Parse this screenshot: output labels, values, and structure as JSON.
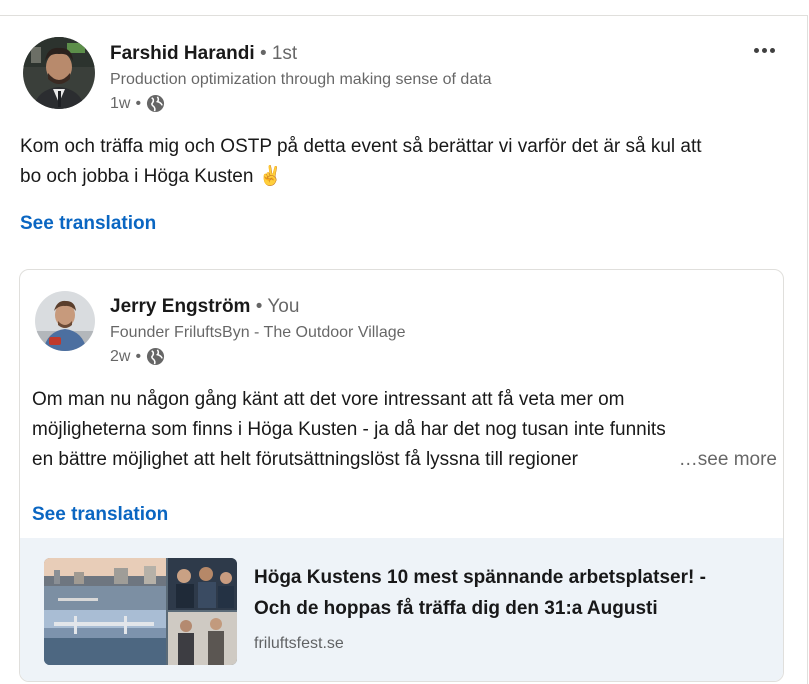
{
  "post": {
    "author": {
      "name": "Farshid Harandi",
      "degree": "• 1st",
      "headline": "Production optimization through making sense of data",
      "time": "1w",
      "dot": "•",
      "visibility_icon": "globe-icon"
    },
    "more_icon": "ellipsis-icon",
    "text_lines": [
      "Kom och träffa mig och OSTP på detta event så berättar vi varför det är så kul att",
      "bo och jobba i Höga Kusten ✌️"
    ],
    "see_translation": "See translation"
  },
  "reshared": {
    "author": {
      "name": "Jerry Engström",
      "degree": "• You",
      "headline": "Founder FriluftsByn - The Outdoor Village",
      "time": "2w",
      "dot": "•",
      "visibility_icon": "globe-icon"
    },
    "text_lines": [
      "Om man nu någon gång känt att det vore intressant att få veta mer om",
      "möjligheterna som finns i Höga Kusten - ja då har det nog tusan inte funnits",
      "en bättre möjlighet att helt förutsättningslöst få lyssna till regioner"
    ],
    "see_more": "…see more",
    "see_translation": "See translation",
    "link_preview": {
      "title_line1": "Höga Kustens 10 mest spännande arbetsplatser! -",
      "title_line2": "Och de hoppas få träffa dig den 31:a Augusti",
      "domain": "friluftsfest.se"
    }
  },
  "colors": {
    "link_blue": "#0a66c2",
    "preview_bg": "#eef3f8",
    "border": "#e0dfdc"
  }
}
